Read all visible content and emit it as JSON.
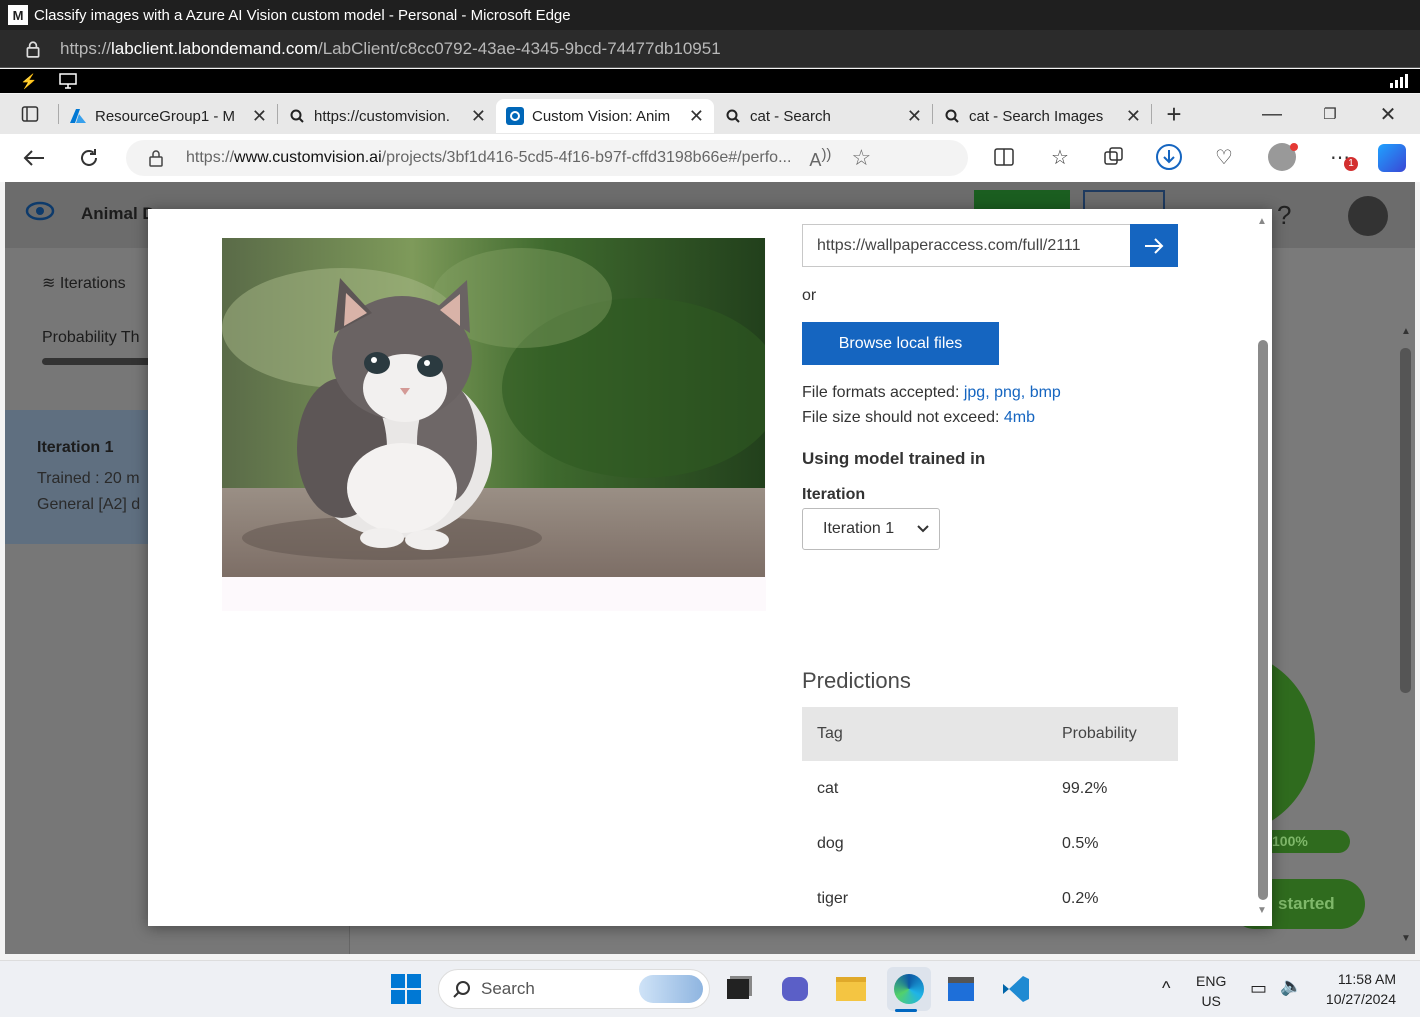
{
  "window": {
    "title": "Classify images with a Azure AI Vision custom model - Personal - Microsoft Edge"
  },
  "lab_url": {
    "prefix": "https://",
    "domain": "labclient.labondemand.com",
    "path": "/LabClient/c8cc0792-43ae-4345-9bcd-74477db10951"
  },
  "tabs": [
    {
      "label": "ResourceGroup1 - M",
      "icon": "azure-icon"
    },
    {
      "label": "https://customvision.",
      "icon": "search-icon"
    },
    {
      "label": "Custom Vision: Anim",
      "icon": "custom-vision-icon",
      "active": true
    },
    {
      "label": "cat - Search",
      "icon": "search-icon"
    },
    {
      "label": "cat - Search Images",
      "icon": "search-icon"
    }
  ],
  "address": {
    "prefix": "https://",
    "domain": "www.customvision.ai",
    "path": "/projects/3bf1d416-5cd5-4f16-b97f-cffd3198b66e#/perfo..."
  },
  "background_page": {
    "project_name": "Animal D",
    "iterations_label": "Iterations",
    "probability_label": "Probability Th",
    "iteration_name": "Iteration 1",
    "trained_text": "Trained : 20 m",
    "domain_text": "General [A2] d",
    "progress_label": "100%",
    "started_label": "started",
    "help": "?"
  },
  "modal": {
    "image_url_value": "https://wallpaperaccess.com/full/2111",
    "or_text": "or",
    "browse_label": "Browse local files",
    "formats_prefix": "File formats accepted: ",
    "formats": [
      "jpg",
      "png",
      "bmp"
    ],
    "size_prefix": "File size should not exceed: ",
    "size_value": "4mb",
    "using_model": "Using model trained in",
    "iteration_label": "Iteration",
    "iteration_selected": "Iteration 1",
    "predictions_title": "Predictions",
    "table_headers": {
      "tag": "Tag",
      "probability": "Probability"
    },
    "predictions": [
      {
        "tag": "cat",
        "probability": "99.2%"
      },
      {
        "tag": "dog",
        "probability": "0.5%"
      },
      {
        "tag": "tiger",
        "probability": "0.2%"
      }
    ]
  },
  "taskbar": {
    "search_placeholder": "Search",
    "lang_top": "ENG",
    "lang_bottom": "US",
    "time": "11:58 AM",
    "date": "10/27/2024"
  },
  "colors": {
    "accent": "#1565c0",
    "green": "#2e7d32"
  }
}
